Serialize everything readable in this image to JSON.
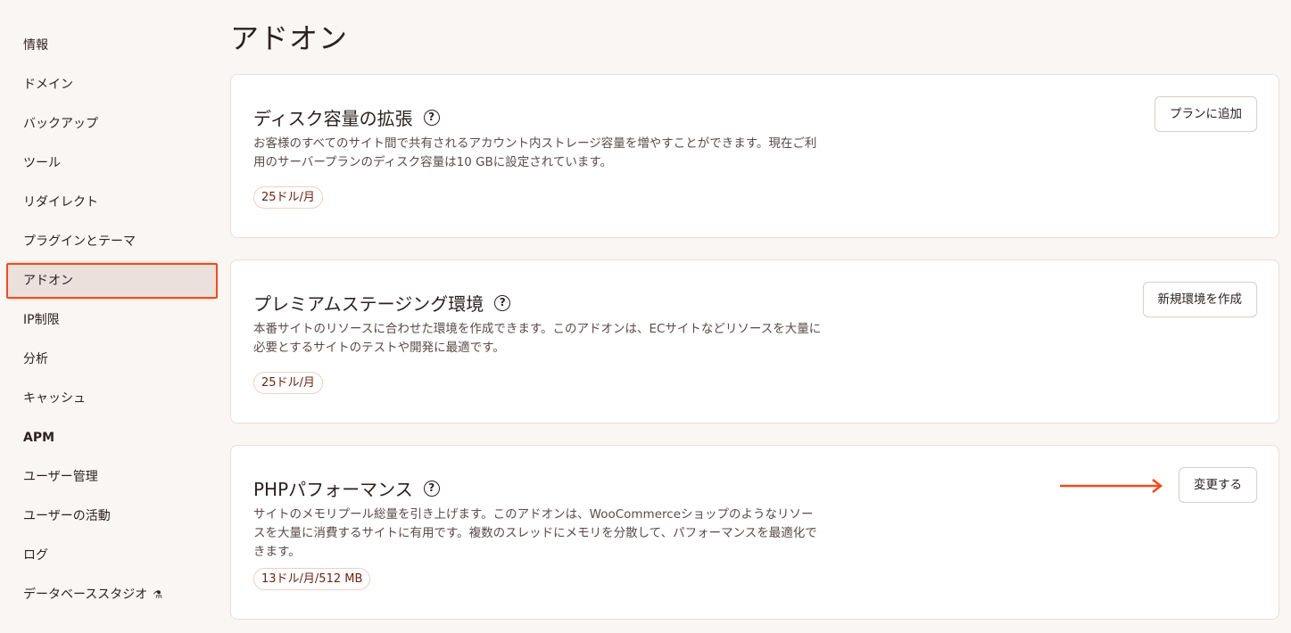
{
  "sidebar": {
    "items": [
      {
        "label": "情報"
      },
      {
        "label": "ドメイン"
      },
      {
        "label": "バックアップ"
      },
      {
        "label": "ツール"
      },
      {
        "label": "リダイレクト"
      },
      {
        "label": "プラグインとテーマ"
      },
      {
        "label": "アドオン"
      },
      {
        "label": "IP制限"
      },
      {
        "label": "分析"
      },
      {
        "label": "キャッシュ"
      },
      {
        "label": "APM"
      },
      {
        "label": "ユーザー管理"
      },
      {
        "label": "ユーザーの活動"
      },
      {
        "label": "ログ"
      },
      {
        "label": "データベーススタジオ"
      }
    ],
    "active_item": "アドオン",
    "flask_glyph": "⚗"
  },
  "page": {
    "title": "アドオン"
  },
  "cards": [
    {
      "title": "ディスク容量の拡張",
      "description": "お客様のすべてのサイト間で共有されるアカウント内ストレージ容量を増やすことができます。現在ご利用のサーバープランのディスク容量は10 GBに設定されています。",
      "price": "25ドル/月",
      "button": "プランに追加"
    },
    {
      "title": "プレミアムステージング環境",
      "description": "本番サイトのリソースに合わせた環境を作成できます。このアドオンは、ECサイトなどリソースを大量に必要とするサイトのテストや開発に最適です。",
      "price": "25ドル/月",
      "button": "新規環境を作成"
    },
    {
      "title": "PHPパフォーマンス",
      "description": "サイトのメモリプール総量を引き上げます。このアドオンは、WooCommerceショップのようなリソースを大量に消費するサイトに有用です。複数のスレッドにメモリを分散して、パフォーマンスを最適化できます。",
      "price": "13ドル/月/512 MB",
      "button": "変更する"
    }
  ],
  "help_glyph": "?",
  "colors": {
    "highlight": "#f24a1d",
    "badge_border": "#f0cfc4",
    "background": "#faf6f4"
  }
}
